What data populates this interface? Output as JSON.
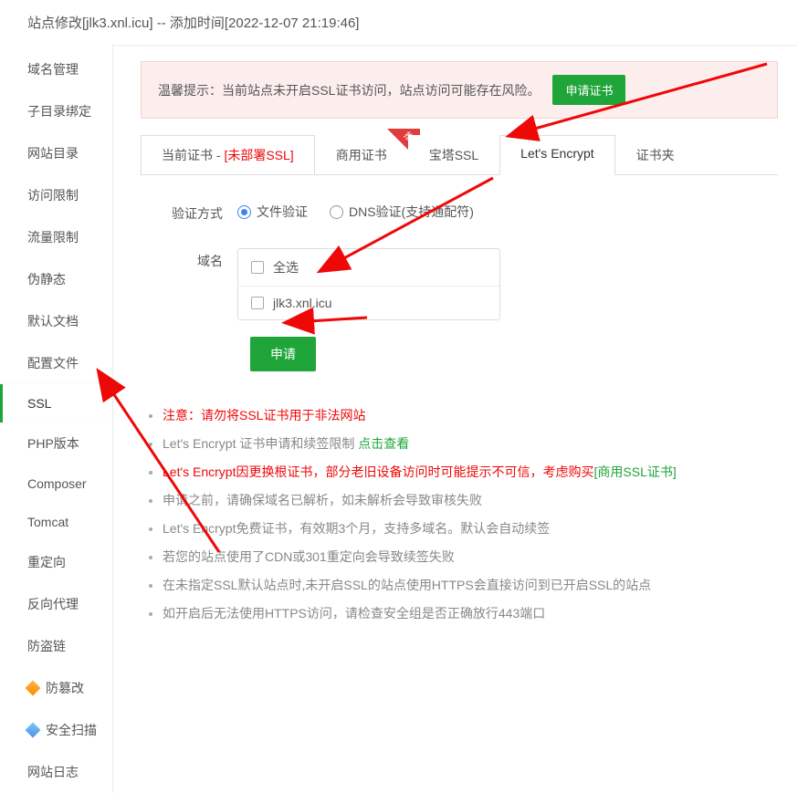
{
  "header": {
    "title": "站点修改[jlk3.xnl.icu] -- 添加时间[2022-12-07 21:19:46]"
  },
  "sidebar": {
    "items": [
      {
        "label": "域名管理"
      },
      {
        "label": "子目录绑定"
      },
      {
        "label": "网站目录"
      },
      {
        "label": "访问限制"
      },
      {
        "label": "流量限制"
      },
      {
        "label": "伪静态"
      },
      {
        "label": "默认文档"
      },
      {
        "label": "配置文件"
      },
      {
        "label": "SSL",
        "active": true
      },
      {
        "label": "PHP版本"
      },
      {
        "label": "Composer"
      },
      {
        "label": "Tomcat"
      },
      {
        "label": "重定向"
      },
      {
        "label": "反向代理"
      },
      {
        "label": "防盗链"
      },
      {
        "label": "防篡改",
        "icon": "diamond-orange"
      },
      {
        "label": "安全扫描",
        "icon": "diamond-blue"
      },
      {
        "label": "网站日志"
      }
    ]
  },
  "notice": {
    "label": "温馨提示：",
    "text": "当前站点未开启SSL证书访问，站点访问可能存在风险。",
    "button": "申请证书"
  },
  "tabs": {
    "items": [
      {
        "label": "当前证书 - ",
        "suffix": "[未部署SSL]"
      },
      {
        "label": "商用证书",
        "ribbon": "推荐"
      },
      {
        "label": "宝塔SSL"
      },
      {
        "label": "Let's Encrypt",
        "active": true
      },
      {
        "label": "证书夹"
      }
    ]
  },
  "form": {
    "verify_label": "验证方式",
    "radioFile": "文件验证",
    "radioDns": "DNS验证(支持通配符)",
    "domain_label": "域名",
    "selectAll": "全选",
    "domain1": "jlk3.xnl.icu",
    "apply": "申请"
  },
  "notes": {
    "items": [
      {
        "text_red": "注意：请勿将SSL证书用于非法网站"
      },
      {
        "text": "Let's Encrypt 证书申请和续签限制 ",
        "link": "点击查看"
      },
      {
        "text_red_full": "Let's Encrypt因更换根证书，部分老旧设备访问时可能提示不可信，考虑购买",
        "link_green": "[商用SSL证书]"
      },
      {
        "text": "申请之前，请确保域名已解析，如未解析会导致审核失败"
      },
      {
        "text": "Let's Encrypt免费证书，有效期3个月，支持多域名。默认会自动续签"
      },
      {
        "text": "若您的站点使用了CDN或301重定向会导致续签失败"
      },
      {
        "text": "在未指定SSL默认站点时,未开启SSL的站点使用HTTPS会直接访问到已开启SSL的站点"
      },
      {
        "text": "如开启后无法使用HTTPS访问，请检查安全组是否正确放行443端口"
      }
    ]
  }
}
